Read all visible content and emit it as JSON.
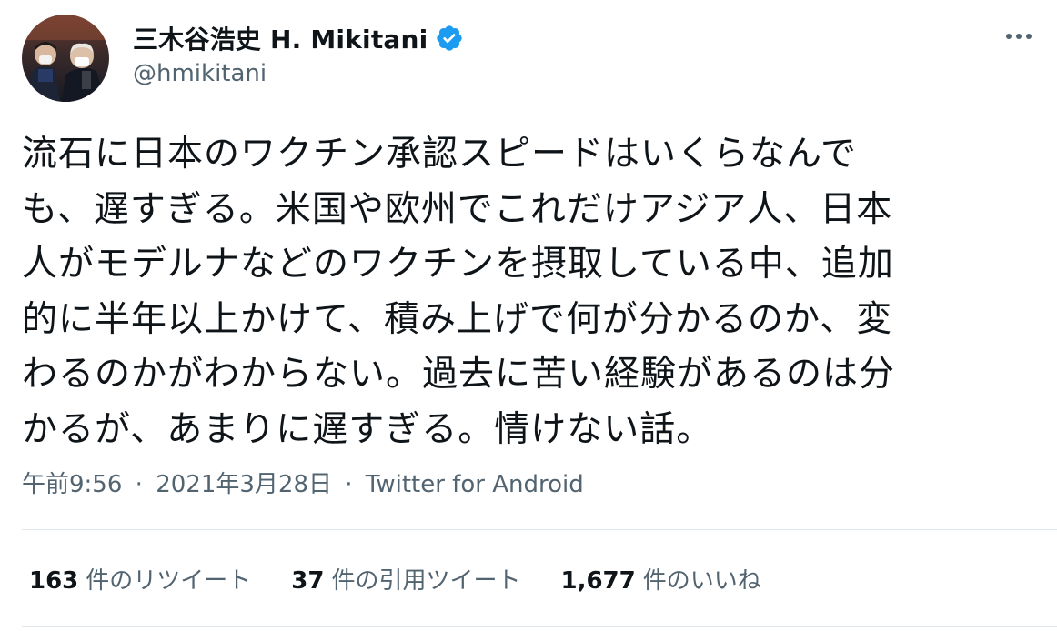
{
  "author": {
    "display_name": "三木谷浩史 H. Mikitani",
    "handle": "@hmikitani",
    "verified": true
  },
  "tweet": {
    "text": "流石に日本のワクチン承認スピードはいくらなんでも、遅すぎる。米国や欧州でこれだけアジア人、日本人がモデルナなどのワクチンを摂取している中、追加的に半年以上かけて、積み上げで何が分かるのか、変わるのかがわからない。過去に苦い経験があるのは分かるが、あまりに遅すぎる。情けない話。",
    "lines": [
      "流石に日本のワクチン承認スピードはいくらなんで",
      "も、遅すぎる。米国や欧州でこれだけアジア人、日本",
      "人がモデルナなどのワクチンを摂取している中、追加",
      "的に半年以上かけて、積み上げで何が分かるのか、変",
      "わるのかがわからない。過去に苦い経験があるのは分",
      "かるが、あまりに遅すぎる。情けない話。"
    ]
  },
  "meta": {
    "time": "午前9:56",
    "date": "2021年3月28日",
    "separator": "·",
    "source": "Twitter for Android"
  },
  "stats": {
    "retweets": {
      "count": "163",
      "label": "件のリツイート"
    },
    "quotes": {
      "count": "37",
      "label": "件の引用ツイート"
    },
    "likes": {
      "count": "1,677",
      "label": "件のいいね"
    }
  },
  "icons": {
    "verified": "verified-badge-icon",
    "more": "more-options-icon"
  },
  "colors": {
    "text_primary": "#0f1419",
    "text_secondary": "#536471",
    "verified_blue": "#1d9bf0",
    "divider": "#e1e8ed"
  }
}
